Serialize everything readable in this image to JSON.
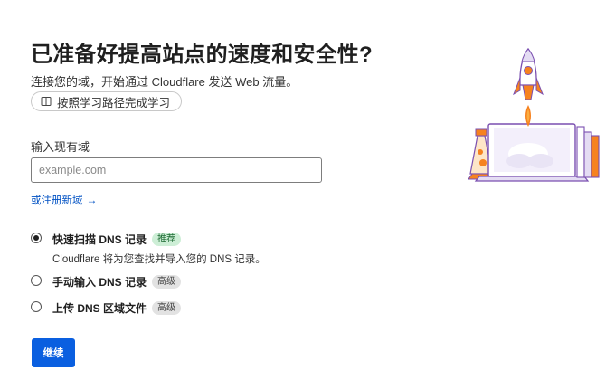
{
  "header": {
    "title": "已准备好提高站点的速度和安全性?",
    "subtitle": "连接您的域，开始通过 Cloudflare 发送 Web 流量。",
    "learn_button": "按照学习路径完成学习"
  },
  "form": {
    "domain_label": "输入现有域",
    "domain_placeholder": "example.com",
    "domain_value": "",
    "register_link": "或注册新域",
    "register_arrow": "→"
  },
  "options": [
    {
      "label": "快速扫描 DNS 记录",
      "badge": "推荐",
      "description": "Cloudflare 将为您查找并导入您的 DNS 记录。",
      "selected": true
    },
    {
      "label": "手动输入 DNS 记录",
      "badge": "高级",
      "selected": false
    },
    {
      "label": "上传 DNS 区域文件",
      "badge": "高级",
      "selected": false
    }
  ],
  "actions": {
    "continue_label": "继续"
  },
  "icons": {
    "learn_icon": "book-icon",
    "register_icon": "arrow-right-icon",
    "illustration": "rocket-laptop-illustration"
  },
  "colors": {
    "primary": "#0a5fe0",
    "link": "#0051c3",
    "badge_recommended_bg": "#cdeed6",
    "badge_advanced_bg": "#e2e2e2"
  }
}
